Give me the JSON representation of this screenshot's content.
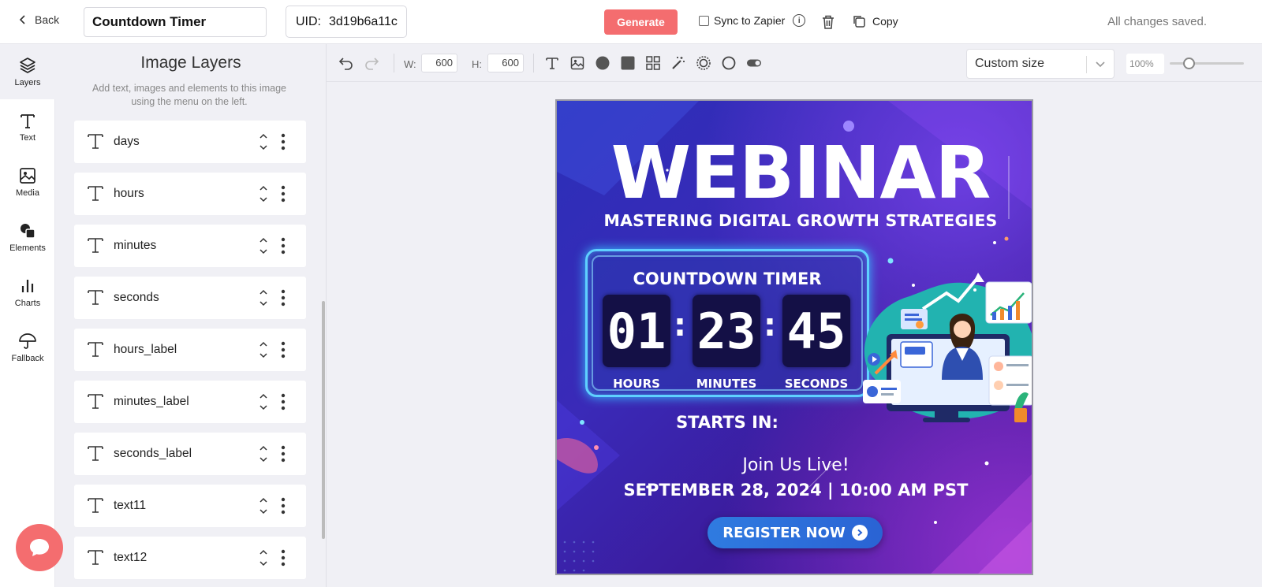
{
  "header": {
    "back_label": "Back",
    "template_name": "Countdown Timer",
    "uid_label": "UID:",
    "uid_value": "3d19b6a11c",
    "generate_label": "Generate",
    "sync_label": "Sync to Zapier",
    "copy_label": "Copy",
    "status_text": "All changes saved."
  },
  "rail": {
    "items": [
      {
        "label": "Layers",
        "icon": "layers-icon"
      },
      {
        "label": "Text",
        "icon": "text-icon"
      },
      {
        "label": "Media",
        "icon": "image-icon"
      },
      {
        "label": "Elements",
        "icon": "shapes-icon"
      },
      {
        "label": "Charts",
        "icon": "bar-chart-icon"
      },
      {
        "label": "Fallback",
        "icon": "umbrella-icon"
      }
    ]
  },
  "layers_panel": {
    "title": "Image Layers",
    "subtitle": "Add text, images and elements to this image using the menu on the left.",
    "layers": [
      {
        "name": "days",
        "type": "text"
      },
      {
        "name": "hours",
        "type": "text"
      },
      {
        "name": "minutes",
        "type": "text"
      },
      {
        "name": "seconds",
        "type": "text"
      },
      {
        "name": "hours_label",
        "type": "text"
      },
      {
        "name": "minutes_label",
        "type": "text"
      },
      {
        "name": "seconds_label",
        "type": "text"
      },
      {
        "name": "text11",
        "type": "text"
      },
      {
        "name": "text12",
        "type": "text"
      }
    ]
  },
  "toolbar": {
    "width_label": "W:",
    "width_value": "600",
    "height_label": "H:",
    "height_value": "600",
    "size_preset": "Custom size",
    "zoom_level": "100%",
    "zoom_fraction": 0.25,
    "tools": [
      "undo-icon",
      "redo-icon",
      "text-tool-icon",
      "image-tool-icon",
      "circle-tool-icon",
      "square-tool-icon",
      "grid-tool-icon",
      "magic-wand-icon",
      "ring-tool-icon",
      "outline-circle-icon",
      "toggle-tool-icon"
    ]
  },
  "canvas": {
    "headline": "WEBINAR",
    "subtitle": "MASTERING DIGITAL GROWTH STRATEGIES",
    "countdown_title": "COUNTDOWN TIMER",
    "hours": "01",
    "minutes": "23",
    "seconds": "45",
    "separator": ":",
    "hours_label": "HOURS",
    "minutes_label": "MINUTES",
    "seconds_label": "SECONDS",
    "starts_in": "STARTS IN:",
    "join_text": "Join Us Live!",
    "date_text": "SEPTEMBER 28, 2024 | 10:00 AM PST",
    "cta_label": "REGISTER NOW"
  },
  "colors": {
    "accent": "#f46d6f",
    "canvas_bg": "#3a2ab8",
    "cta_blue": "#2f7be0",
    "timer_glow": "#5fd0ff"
  }
}
